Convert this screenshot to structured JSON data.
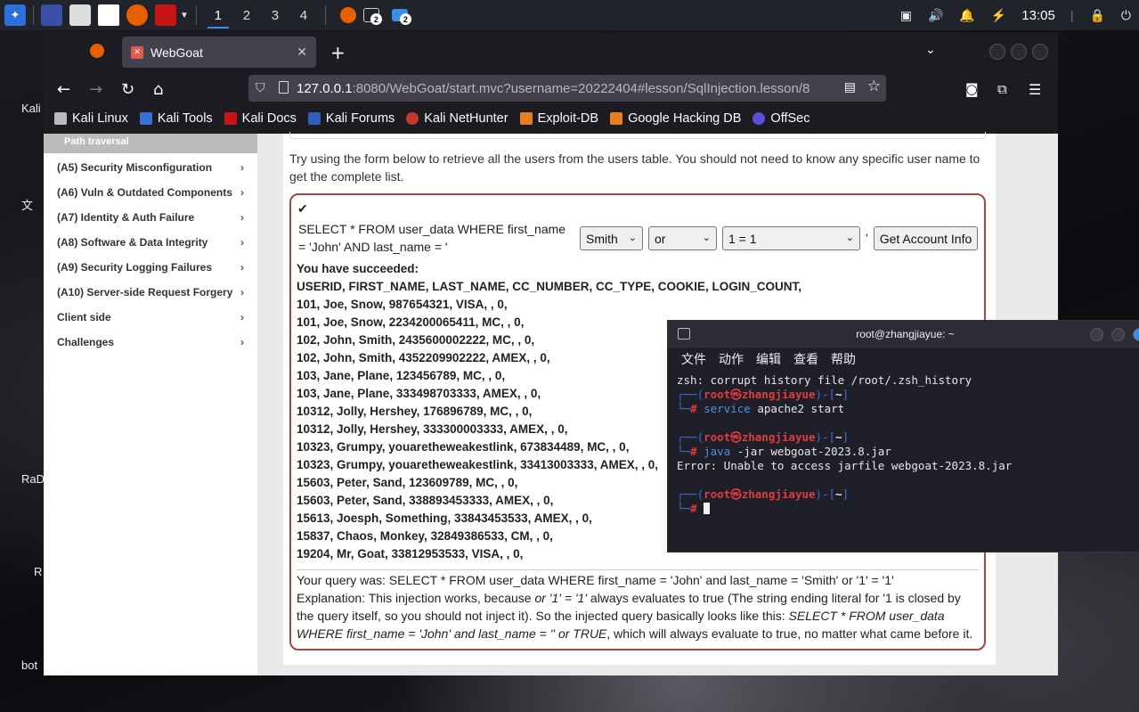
{
  "desktop": {
    "labels": [
      "Kali",
      "文",
      "RaD",
      "R",
      "bot"
    ]
  },
  "taskbar": {
    "workspaces": [
      "1",
      "2",
      "3",
      "4"
    ],
    "badge_terminal": "2",
    "badge_files": "2",
    "clock": "13:05"
  },
  "browser": {
    "tab_title": "WebGoat",
    "url_host": "127.0.0.1",
    "url_rest": ":8080/WebGoat/start.mvc?username=20222404#lesson/SqlInjection.lesson/8",
    "bookmarks": [
      "Kali Linux",
      "Kali Tools",
      "Kali Docs",
      "Kali Forums",
      "Kali NetHunter",
      "Exploit-DB",
      "Google Hacking DB",
      "OffSec"
    ]
  },
  "sidebar": {
    "sub_item": "Path traversal",
    "items": [
      "(A5) Security Misconfiguration",
      "(A6) Vuln & Outdated Components",
      "(A7) Identity & Auth Failure",
      "(A8) Software & Data Integrity",
      "(A9) Security Logging Failures",
      "(A10) Server-side Request Forgery",
      "Client side",
      "Challenges"
    ]
  },
  "lesson": {
    "intro": "Try using the form below to retrieve all the users from the users table. You should not need to know any specific user name to get the complete list.",
    "sql_text": "SELECT * FROM user_data WHERE first_name = 'John' AND last_name = '",
    "select1": "Smith",
    "select2": "or",
    "select3": "1 = 1",
    "quote": "'",
    "button": "Get Account Info",
    "success": "You have succeeded:",
    "rows": [
      "USERID, FIRST_NAME, LAST_NAME, CC_NUMBER, CC_TYPE, COOKIE, LOGIN_COUNT,",
      "101, Joe, Snow, 987654321, VISA, , 0,",
      "101, Joe, Snow, 2234200065411, MC, , 0,",
      "102, John, Smith, 2435600002222, MC, , 0,",
      "102, John, Smith, 4352209902222, AMEX, , 0,",
      "103, Jane, Plane, 123456789, MC, , 0,",
      "103, Jane, Plane, 333498703333, AMEX, , 0,",
      "10312, Jolly, Hershey, 176896789, MC, , 0,",
      "10312, Jolly, Hershey, 333300003333, AMEX, , 0,",
      "10323, Grumpy, youaretheweakestlink, 673834489, MC, , 0,",
      "10323, Grumpy, youaretheweakestlink, 33413003333, AMEX, , 0,",
      "15603, Peter, Sand, 123609789, MC, , 0,",
      "15603, Peter, Sand, 338893453333, AMEX, , 0,",
      "15613, Joesph, Something, 33843453533, AMEX, , 0,",
      "15837, Chaos, Monkey, 32849386533, CM, , 0,",
      "19204, Mr, Goat, 33812953533, VISA, , 0,"
    ],
    "query": "Your query was: SELECT * FROM user_data WHERE first_name = 'John' and last_name = 'Smith' or '1' = '1'",
    "expl_1": "Explanation: This injection works, because ",
    "expl_2": "or '1' = '1'",
    "expl_3": " always evaluates to true (The string ending literal for '1 is closed by the query itself, so you should not inject it). So the injected query basically looks like this: ",
    "expl_4": "SELECT * FROM user_data WHERE first_name = 'John' and last_name = '' or TRUE",
    "expl_5": ", which will always evaluate to true, no matter what came before it."
  },
  "terminal": {
    "title": "root@zhangjiayue: ~",
    "menu": [
      "文件",
      "动作",
      "编辑",
      "查看",
      "帮助"
    ],
    "line1": "zsh: corrupt history file /root/.zsh_history",
    "user": "root",
    "at": "㉿",
    "host": "zhangjiayue",
    "dir": "~",
    "cmd1_a": "service",
    "cmd1_b": " apache2 start",
    "cmd2_a": "java",
    "cmd2_b": " -jar webgoat-2023.8.jar",
    "err": "Error: Unable to access jarfile webgoat-2023.8.jar"
  }
}
